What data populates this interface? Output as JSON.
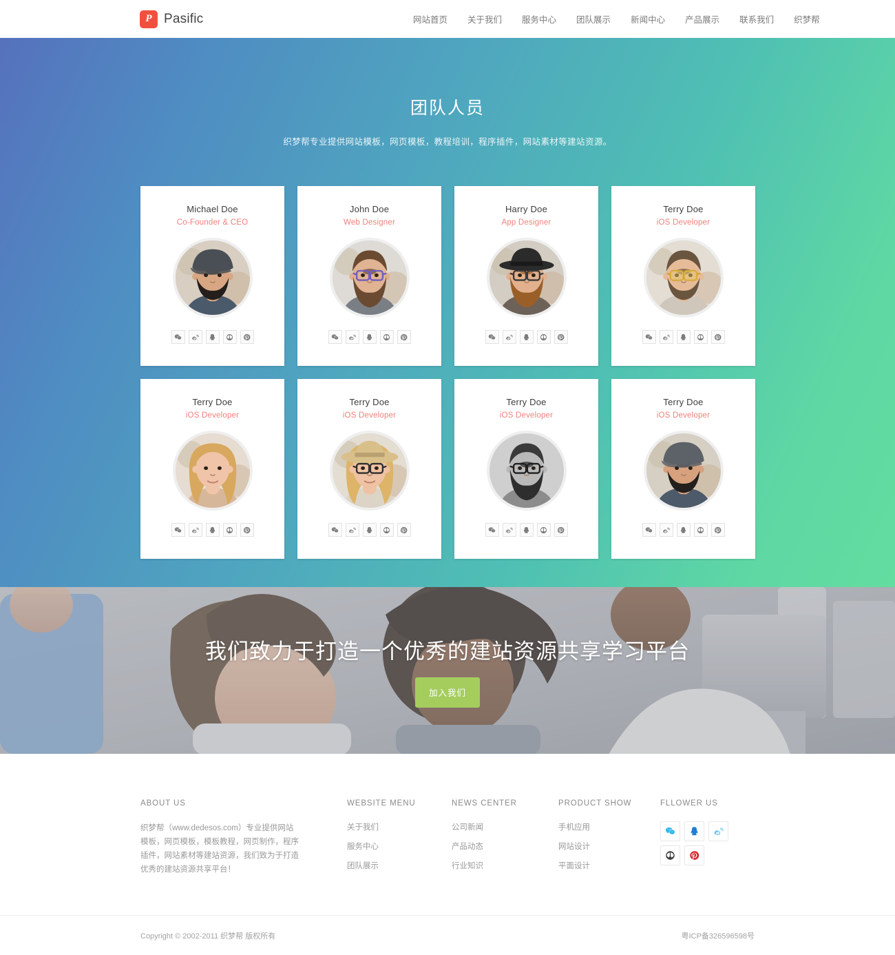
{
  "header": {
    "brand_mark": "P",
    "brand_name": "Pasific",
    "nav": [
      {
        "label": "网站首页"
      },
      {
        "label": "关于我们"
      },
      {
        "label": "服务中心"
      },
      {
        "label": "团队展示"
      },
      {
        "label": "新闻中心"
      },
      {
        "label": "产品展示"
      },
      {
        "label": "联系我们"
      },
      {
        "label": "织梦帮"
      }
    ]
  },
  "team": {
    "title": "团队人员",
    "subtitle": "织梦帮专业提供网站模板，网页模板，教程培训，程序插件，网站素材等建站资源。",
    "gradient_from": "#5671bd",
    "gradient_to": "#63dda0",
    "role_color": "#f1807b",
    "social_icons": [
      "wechat-icon",
      "weibo-icon",
      "qq-icon",
      "renren-icon",
      "pinterest-icon"
    ],
    "members": [
      {
        "name": "Michael Doe",
        "role": "Co-Founder & CEO",
        "photo": "man-flat-cap-beard"
      },
      {
        "name": "John Doe",
        "role": "Web Designer",
        "photo": "man-glasses-long-beard"
      },
      {
        "name": "Harry Doe",
        "role": "App Designer",
        "photo": "man-hat-red-beard"
      },
      {
        "name": "Terry Doe",
        "role": "iOS Developer",
        "photo": "man-yellow-glasses"
      },
      {
        "name": "Terry Doe",
        "role": "iOS Developer",
        "photo": "woman-blonde-wavy"
      },
      {
        "name": "Terry Doe",
        "role": "iOS Developer",
        "photo": "woman-straw-hat-glasses"
      },
      {
        "name": "Terry Doe",
        "role": "iOS Developer",
        "photo": "man-bw-glasses-beard"
      },
      {
        "name": "Terry Doe",
        "role": "iOS Developer",
        "photo": "man-cap-suit-beard"
      }
    ]
  },
  "cta": {
    "title": "我们致力于打造一个优秀的建站资源共享学习平台",
    "button_label": "加入我们",
    "button_color": "#a5cd5e"
  },
  "footer": {
    "about": {
      "title": "ABOUT US",
      "text": "织梦帮（www.dedesos.com）专业提供网站模板，网页模板，模板教程，网页制作，程序插件，网站素材等建站资源，我们致为于打造优秀的建站资源共享平台！"
    },
    "menu": {
      "title": "WEBSITE MENU",
      "links": [
        "关于我们",
        "服务中心",
        "团队展示"
      ]
    },
    "news": {
      "title": "NEWS CENTER",
      "links": [
        "公司新闻",
        "产品动态",
        "行业知识"
      ]
    },
    "product": {
      "title": "PRODUCT SHOW",
      "links": [
        "手机应用",
        "网站设计",
        "平面设计"
      ]
    },
    "follow": {
      "title": "FLLOWER US",
      "icons": [
        "wechat-icon",
        "qq-icon",
        "weibo-icon",
        "renren-icon",
        "pinterest-icon"
      ]
    },
    "copyright": "Copyright © 2002-2011 织梦帮 版权所有",
    "icp": "粤ICP备326596598号"
  }
}
